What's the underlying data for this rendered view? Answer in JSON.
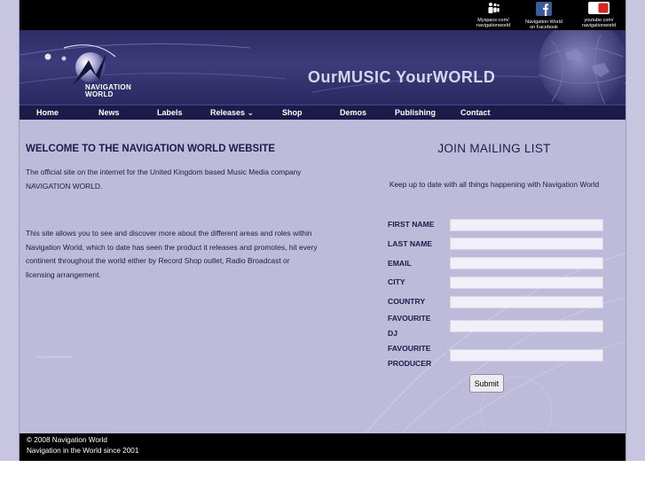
{
  "social": [
    {
      "name": "myspace",
      "label_line1": "Myspace.com/",
      "label_line2": "navigationworld"
    },
    {
      "name": "facebook",
      "label_line1": "Navigation World",
      "label_line2": "on Facebook"
    },
    {
      "name": "youtube",
      "label_line1": "youtube.com/",
      "label_line2": "navigationworld",
      "icon_text": "You Tube"
    }
  ],
  "banner": {
    "brand_line1": "NAVIGATION",
    "brand_line2": "WORLD",
    "tagline": "OurMUSIC YourWORLD"
  },
  "nav": [
    {
      "label": "Home"
    },
    {
      "label": "News"
    },
    {
      "label": "Labels"
    },
    {
      "label": "Releases ⌄"
    },
    {
      "label": "Shop"
    },
    {
      "label": "Demos"
    },
    {
      "label": "Publishing"
    },
    {
      "label": "Contact"
    }
  ],
  "welcome": {
    "title": "WELCOME TO THE NAVIGATION WORLD WEBSITE",
    "para1": "The official site on the internet for the United Kingdom based Music Media company NAVIGATION WORLD.",
    "para2": "This site allows you to see and discover more about the different areas and roles within Navigation World, which to date has seen the product it releases and promotes, hit every continent throughout the world either by Record Shop outlet, Radio Broadcast or licensing arrangement."
  },
  "mailing": {
    "title": "JOIN MAILING LIST",
    "description": "Keep up to date with all things happening with Navigation World",
    "fields": [
      {
        "label_line1": "FIRST NAME",
        "label_line2": "",
        "value": ""
      },
      {
        "label_line1": "LAST NAME",
        "label_line2": "",
        "value": ""
      },
      {
        "label_line1": "EMAIL",
        "label_line2": "",
        "value": ""
      },
      {
        "label_line1": "CITY",
        "label_line2": "",
        "value": ""
      },
      {
        "label_line1": "COUNTRY",
        "label_line2": "",
        "value": ""
      },
      {
        "label_line1": "FAVOURITE",
        "label_line2": "DJ",
        "value": ""
      },
      {
        "label_line1": "FAVOURITE",
        "label_line2": "PRODUCER",
        "value": ""
      }
    ],
    "submit_label": "Submit"
  },
  "footer": {
    "line1": "© 2008 Navigation World",
    "line2": "Navigation in the World since 2001"
  },
  "colors": {
    "page_bg": "#c7c5df",
    "banner_bg": "#2e2c64",
    "nav_bg": "#1c1a48",
    "text": "#1c1a48"
  }
}
